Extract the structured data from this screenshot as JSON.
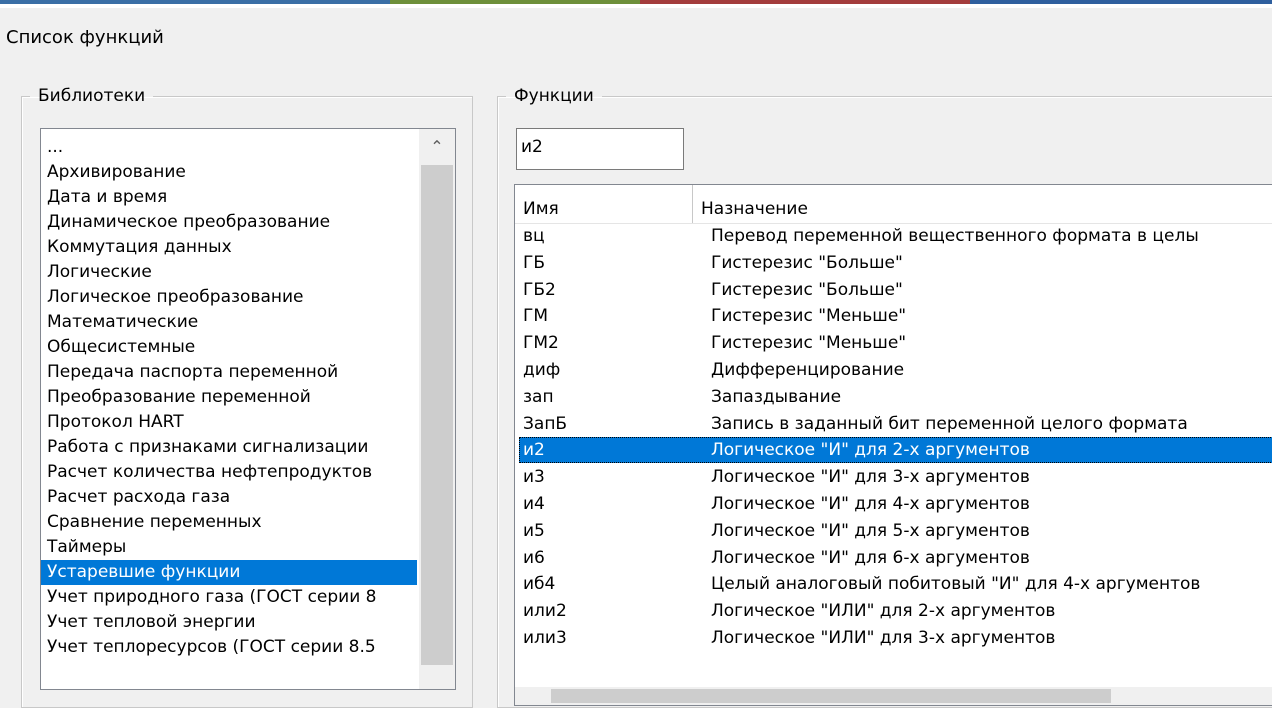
{
  "window": {
    "title": "Список функций"
  },
  "libraries": {
    "legend": "Библиотеки",
    "items": [
      "...",
      "Архивирование",
      "Дата и время",
      "Динамическое преобразование",
      "Коммутация данных",
      "Логические",
      "Логическое преобразование",
      "Математические",
      "Общесистемные",
      "Передача паспорта переменной",
      "Преобразование переменной",
      "Протокол HART",
      "Работа с признаками сигнализации",
      "Расчет количества нефтепродуктов",
      "Расчет расхода газа",
      "Сравнение переменных",
      "Таймеры",
      "Устаревшие функции",
      "Учет природного газа (ГОСТ серии 8",
      "Учет тепловой энергии",
      "Учет теплоресурсов (ГОСТ серии 8.5"
    ],
    "selected_index": 17,
    "scroll_up_icon": "chevron-up-icon"
  },
  "functions": {
    "legend": "Функции",
    "search_value": "и2",
    "columns": [
      "Имя",
      "Назначение"
    ],
    "rows": [
      {
        "name": "вц",
        "desc": "Перевод переменной вещественного формата  в целы"
      },
      {
        "name": "ГБ",
        "desc": "Гистерезис \"Больше\""
      },
      {
        "name": "ГБ2",
        "desc": "Гистерезис \"Больше\""
      },
      {
        "name": "ГМ",
        "desc": "Гистерезис \"Меньше\""
      },
      {
        "name": "ГМ2",
        "desc": "Гистерезис \"Меньше\""
      },
      {
        "name": "диф",
        "desc": "Дифференцирование"
      },
      {
        "name": "зап",
        "desc": "Запаздывание"
      },
      {
        "name": "ЗапБ",
        "desc": "Запись в заданный бит переменной целого формата"
      },
      {
        "name": "и2",
        "desc": "Логическое \"И\" для 2-х аргументов"
      },
      {
        "name": "и3",
        "desc": "Логическое \"И\" для 3-х аргументов"
      },
      {
        "name": "и4",
        "desc": "Логическое \"И\" для 4-х аргументов"
      },
      {
        "name": "и5",
        "desc": "Логическое \"И\" для 5-х аргументов"
      },
      {
        "name": "и6",
        "desc": "Логическое \"И\" для 6-х аргументов"
      },
      {
        "name": "иб4",
        "desc": "Целый аналоговый побитовый \"И\" для 4-х аргументов"
      },
      {
        "name": "или2",
        "desc": "Логическое \"ИЛИ\" для 2-х аргументов"
      },
      {
        "name": "или3",
        "desc": "Логическое \"ИЛИ\" для 3-х аргументов"
      }
    ],
    "selected_index": 8
  },
  "colors": {
    "selection": "#0078d7",
    "window_bg": "#f0f0f0",
    "border": "#828790"
  }
}
